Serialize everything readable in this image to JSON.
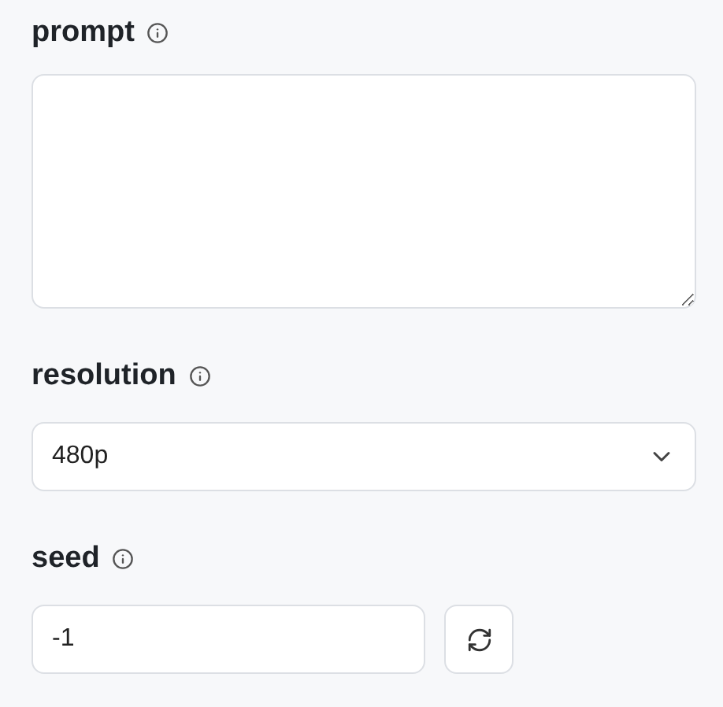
{
  "fields": [
    {
      "kind": "textarea",
      "label": "prompt"
    },
    {
      "kind": "select",
      "label": "resolution",
      "value": "480p"
    },
    {
      "kind": "number",
      "label": "seed",
      "value": "-1"
    }
  ]
}
